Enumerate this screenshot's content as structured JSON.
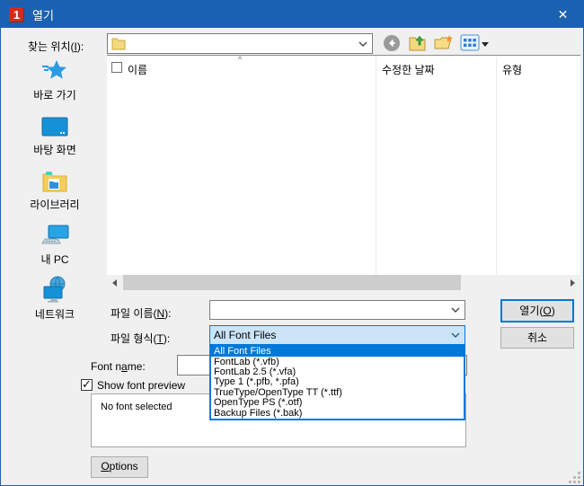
{
  "window": {
    "title": "열기",
    "close_glyph": "✕"
  },
  "colors": {
    "titlebar": "#1b61b1",
    "selection": "#0078d7",
    "combo_open_fill": "#cce4f7",
    "accent_border": "#0078d7"
  },
  "address_bar": {
    "label": {
      "pre": "찾는 위치(",
      "key": "I",
      "post": "):"
    },
    "value": ""
  },
  "toolbar": {
    "back_icon": "go-back",
    "up_icon": "up-one-level",
    "new_folder_icon": "create-new-folder",
    "views_icon": "view-menu"
  },
  "sidebar": {
    "items": [
      {
        "label": "바로 가기",
        "icon": "quick-access-star"
      },
      {
        "label": "바탕 화면",
        "icon": "desktop-screen"
      },
      {
        "label": "라이브러리",
        "icon": "libraries-folder"
      },
      {
        "label": "내 PC",
        "icon": "this-pc-computer"
      },
      {
        "label": "네트워크",
        "icon": "network-globe"
      }
    ]
  },
  "file_list": {
    "columns": {
      "name": "이름",
      "modified": "수정한 날짜",
      "type": "유형"
    },
    "sort_glyph": "^",
    "rows": []
  },
  "form": {
    "file_name_label": {
      "pre": "파일 이름(",
      "key": "N",
      "post": "):"
    },
    "file_name_value": "",
    "file_type_label": {
      "pre": "파일 형식(",
      "key": "T",
      "post": "):"
    },
    "file_type_value": "All Font Files",
    "font_name_label": {
      "pre": "Font n",
      "key": "a",
      "post": "me:"
    },
    "show_preview_label": "Show font preview",
    "show_preview_checked": "✓",
    "preview_text": "No font selected"
  },
  "buttons": {
    "open": {
      "pre": "열기(",
      "key": "O",
      "post": ")"
    },
    "cancel": "취소",
    "options": {
      "pre": "",
      "key": "O",
      "post": "ptions"
    }
  },
  "file_type_dropdown": {
    "selected_index": 0,
    "items": [
      "All Font Files",
      "FontLab (*.vfb)",
      "FontLab 2.5 (*.vfa)",
      "Type 1 (*.pfb, *.pfa)",
      "TrueType/OpenType TT (*.ttf)",
      "OpenType PS (*.otf)",
      "Backup Files (*.bak)"
    ]
  }
}
